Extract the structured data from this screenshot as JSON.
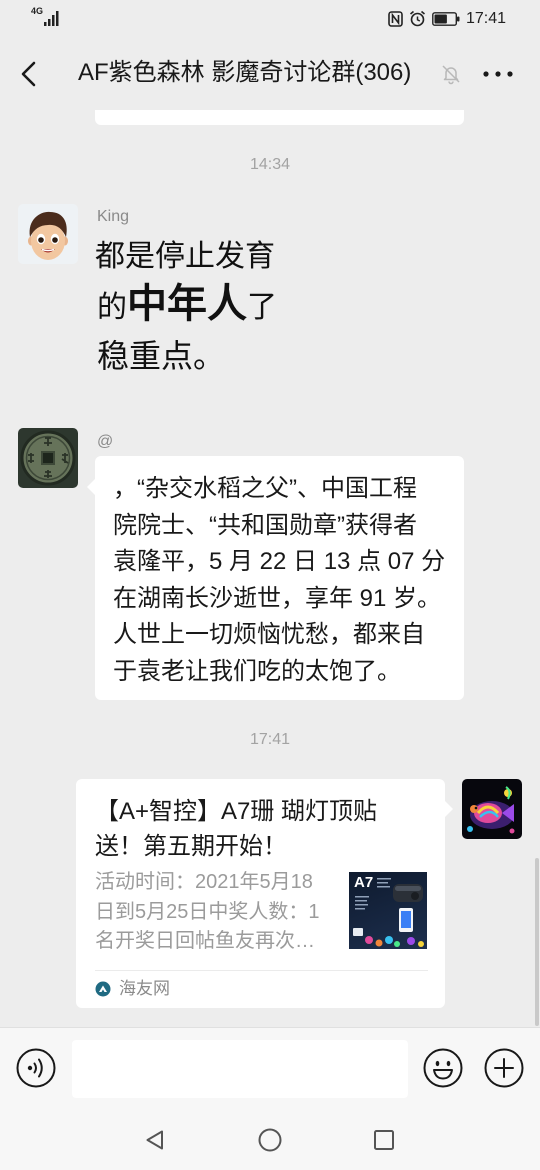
{
  "status_bar": {
    "network": "4G",
    "time": "17:41",
    "battery_level": 0.62,
    "icons": [
      "signal-icon",
      "nfc-icon",
      "alarm-icon",
      "battery-icon"
    ]
  },
  "header": {
    "title": "AF紫色森林 影魔奇讨论群(306)",
    "icons": [
      "back-icon",
      "mute-bell-icon",
      "more-icon"
    ]
  },
  "chat": {
    "timestamp_1": "14:34",
    "msg_king": {
      "sender": "King",
      "avatar_icon": "cartoon-boy-avatar",
      "sticker": {
        "line1": "都是停止发育",
        "line2_pre": "的",
        "line2_em": "中年人",
        "line2_post": "了",
        "line3": "稳重点。"
      }
    },
    "msg_at": {
      "sender": "@",
      "avatar_icon": "ancient-coin-avatar",
      "lines": [
        "，“杂交水稻之父”、中国工程",
        "院院士、“共和国勋章”获得者",
        "袁隆平，5 月 22 日 13 点 07 分",
        "在湖南长沙逝世，享年 91 岁。",
        "人世上一切烦恼忧愁，都来自",
        "于袁老让我们吃的太饱了。"
      ]
    },
    "timestamp_2": "17:41",
    "msg_self": {
      "avatar_icon": "coral-fish-avatar",
      "card": {
        "title_lines": [
          "【A+智控】A7珊 瑚灯顶贴",
          "送！第五期开始！"
        ],
        "desc_lines": [
          "活动时间：2021年5月18",
          "日到5月25日中奖人数：1",
          "名开奖日回帖鱼友再次…"
        ],
        "thumb_title": "A7",
        "source": "海友网",
        "source_icon": "haiyou-logo-icon"
      }
    }
  },
  "input_bar": {
    "text": "",
    "icons": [
      "voice-icon",
      "emoji-icon",
      "plus-icon"
    ]
  },
  "nav_bar": {
    "icons": [
      "nav-back-icon",
      "nav-home-icon",
      "nav-recents-icon"
    ]
  },
  "colors": {
    "chat_background": "#ededed",
    "bubble": "#ffffff",
    "text": "#191919",
    "secondary_text": "#9b9b9b",
    "timestamp": "#a3a3a3"
  }
}
